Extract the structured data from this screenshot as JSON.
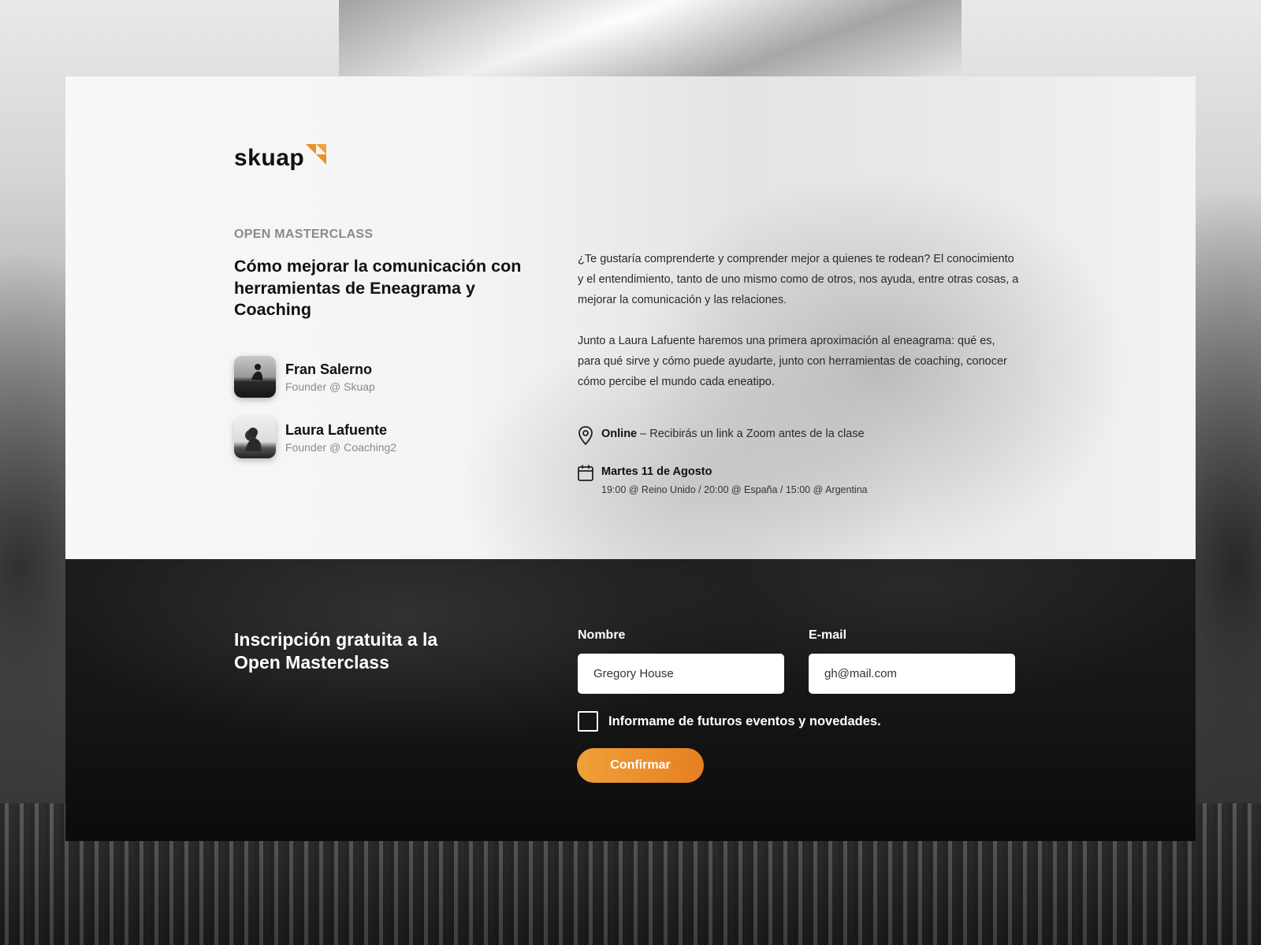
{
  "brand": {
    "name": "skuap",
    "accent_color": "#ec8f2b"
  },
  "event": {
    "eyebrow": "OPEN MASTERCLASS",
    "title": "Cómo mejorar la comunicación con herramientas de Eneagrama y Coaching",
    "description_1": "¿Te gustaría comprenderte y comprender mejor a quienes te rodean?  El conocimiento y el entendimiento, tanto de uno mismo como de otros, nos ayuda, entre otras cosas, a mejorar la comunicación y las relaciones.",
    "description_2": "Junto a Laura Lafuente haremos una primera aproximación al eneagrama: qué es, para qué sirve y cómo puede ayudarte, junto con herramientas de coaching, conocer cómo percibe el mundo cada eneatipo.",
    "location_bold": "Online",
    "location_text": " – Recibirás un link a Zoom antes de la clase",
    "date": "Martes 11 de Agosto",
    "times": "19:00 @ Reino Unido / 20:00 @ España / 15:00 @ Argentina"
  },
  "speakers": [
    {
      "name": "Fran Salerno",
      "role": "Founder @ Skuap"
    },
    {
      "name": "Laura Lafuente",
      "role": "Founder @ Coaching2"
    }
  ],
  "registration": {
    "title": "Inscripción gratuita a la Open Masterclass",
    "name_label": "Nombre",
    "name_value": "Gregory House",
    "email_label": "E-mail",
    "email_value": "gh@mail.com",
    "newsletter_label": "Informame de futuros eventos y novedades.",
    "newsletter_checked": false,
    "confirm_label": "Confirmar"
  },
  "icons": {
    "location": "map-pin-icon",
    "date": "calendar-icon"
  }
}
